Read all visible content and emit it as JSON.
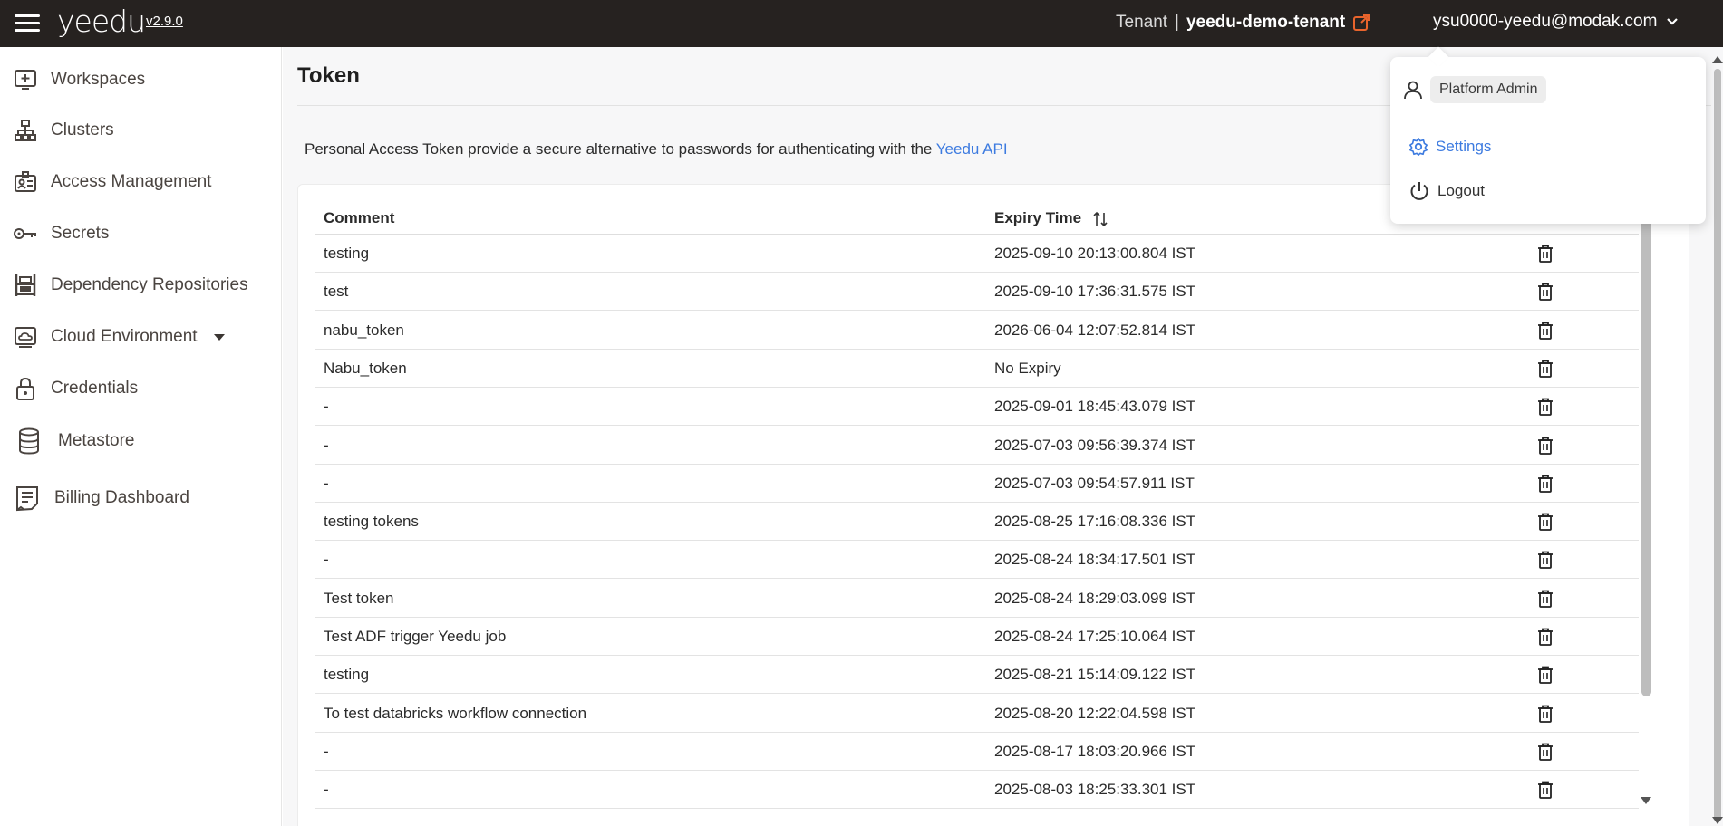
{
  "header": {
    "logo": "yeedu",
    "version": "v2.9.0",
    "tenant_label": "Tenant",
    "tenant_separator": "|",
    "tenant_name": "yeedu-demo-tenant",
    "user_email": "ysu0000-yeedu@modak.com"
  },
  "sidebar": {
    "items": [
      {
        "label": "Workspaces",
        "icon": "add-box-icon"
      },
      {
        "label": "Clusters",
        "icon": "cluster-tree-icon"
      },
      {
        "label": "Access Management",
        "icon": "id-badge-icon"
      },
      {
        "label": "Secrets",
        "icon": "key-icon"
      },
      {
        "label": "Dependency Repositories",
        "icon": "repository-icon"
      },
      {
        "label": "Cloud Environment",
        "icon": "cloud-monitor-icon"
      },
      {
        "label": "Credentials",
        "icon": "lock-icon"
      },
      {
        "label": "Metastore",
        "icon": "database-icon"
      },
      {
        "label": "Billing Dashboard",
        "icon": "receipt-icon"
      }
    ]
  },
  "page": {
    "title": "Token",
    "description": "Personal Access Token provide a secure alternative to passwords for authenticating with the",
    "description_link": "Yeedu API"
  },
  "table": {
    "columns": [
      "Comment",
      "Expiry Time"
    ],
    "rows": [
      {
        "comment": "testing",
        "expiry": "2025-09-10 20:13:00.804 IST"
      },
      {
        "comment": "test",
        "expiry": "2025-09-10 17:36:31.575 IST"
      },
      {
        "comment": "nabu_token",
        "expiry": "2026-06-04 12:07:52.814 IST"
      },
      {
        "comment": "Nabu_token",
        "expiry": "No Expiry"
      },
      {
        "comment": "-",
        "expiry": "2025-09-01 18:45:43.079 IST"
      },
      {
        "comment": "-",
        "expiry": "2025-07-03 09:56:39.374 IST"
      },
      {
        "comment": "-",
        "expiry": "2025-07-03 09:54:57.911 IST"
      },
      {
        "comment": "testing tokens",
        "expiry": "2025-08-25 17:16:08.336 IST"
      },
      {
        "comment": "-",
        "expiry": "2025-08-24 18:34:17.501 IST"
      },
      {
        "comment": "Test token",
        "expiry": "2025-08-24 18:29:03.099 IST"
      },
      {
        "comment": "Test ADF trigger Yeedu job",
        "expiry": "2025-08-24 17:25:10.064 IST"
      },
      {
        "comment": "testing",
        "expiry": "2025-08-21 15:14:09.122 IST"
      },
      {
        "comment": "To test databricks workflow connection",
        "expiry": "2025-08-20 12:22:04.598 IST"
      },
      {
        "comment": "-",
        "expiry": "2025-08-17 18:03:20.966 IST"
      },
      {
        "comment": "-",
        "expiry": "2025-08-03 18:25:33.301 IST"
      }
    ]
  },
  "user_menu": {
    "role": "Platform Admin",
    "settings": "Settings",
    "logout": "Logout"
  },
  "colors": {
    "topbar": "#262220",
    "accent_link": "#3d7be0",
    "external_link_icon": "#e8642c"
  }
}
